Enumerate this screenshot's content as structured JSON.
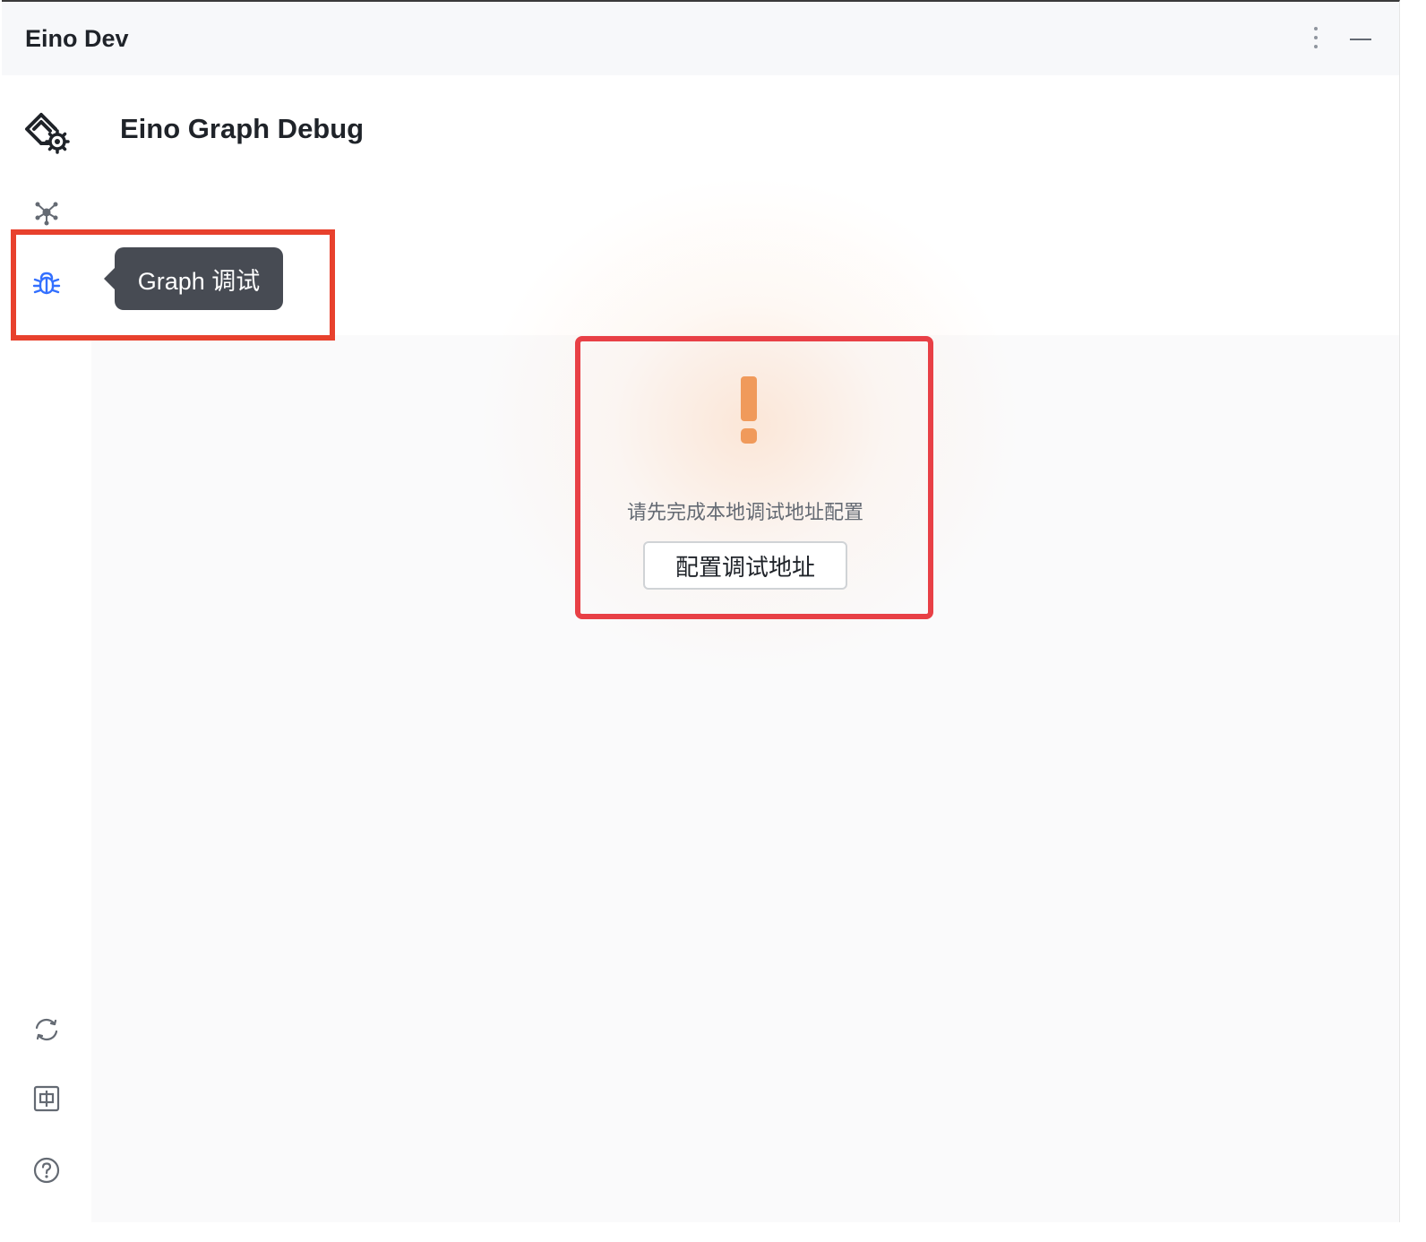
{
  "window": {
    "title": "Eino Dev"
  },
  "titlebar": {
    "more_icon": "more-vertical-icon",
    "minimize_icon": "minimize-icon"
  },
  "sidebar": {
    "logo_icon": "eino-logo-gear-icon",
    "app_name": "Eino Graph Debug",
    "items": [
      {
        "icon": "graph-nodes-icon"
      },
      {
        "icon": "bug-icon",
        "tooltip": "Graph 调试",
        "active": true
      }
    ],
    "bottom": [
      {
        "icon": "refresh-icon"
      },
      {
        "icon": "language-zh-icon",
        "glyph": "中"
      },
      {
        "icon": "help-circle-icon",
        "glyph": "?"
      }
    ]
  },
  "main": {
    "empty_state": {
      "icon": "warning-exclamation-icon",
      "message": "请先完成本地调试地址配置",
      "button_label": "配置调试地址"
    }
  },
  "colors": {
    "accent": "#3370ff",
    "warning": "#f09a5b",
    "tooltip_bg": "#474b53",
    "highlight": "#e8412d"
  }
}
